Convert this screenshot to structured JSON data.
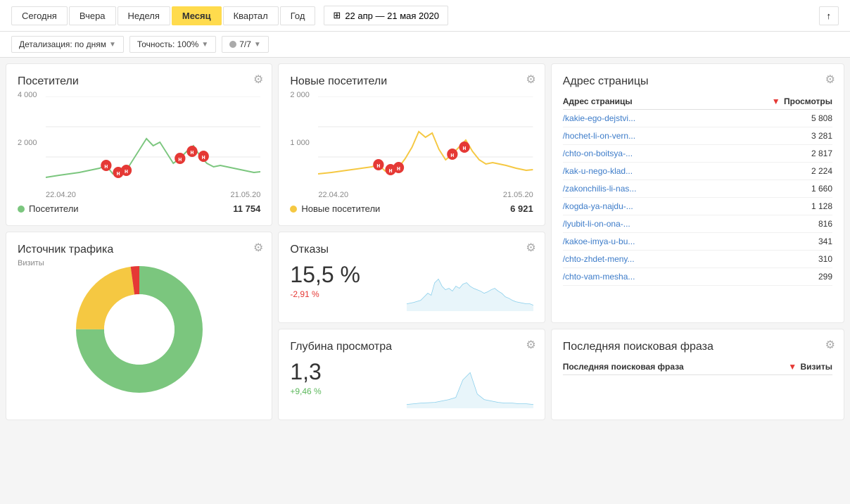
{
  "header": {
    "period_tabs": [
      {
        "label": "Сегодня",
        "active": false
      },
      {
        "label": "Вчера",
        "active": false
      },
      {
        "label": "Неделя",
        "active": false
      },
      {
        "label": "Месяц",
        "active": true
      },
      {
        "label": "Квартал",
        "active": false
      },
      {
        "label": "Год",
        "active": false
      }
    ],
    "date_range": "22 апр — 21 мая 2020",
    "export_icon": "↑"
  },
  "filters": {
    "detail_label": "Детализация: по дням",
    "accuracy_label": "Точность: 100%",
    "segments_label": "7/7"
  },
  "visitors_card": {
    "title": "Посетители",
    "y_labels": [
      "4 000",
      "2 000"
    ],
    "date_start": "22.04.20",
    "date_end": "21.05.20",
    "legend": "Посетители",
    "value": "11 754",
    "dot_color": "#7bc67e"
  },
  "new_visitors_card": {
    "title": "Новые посетители",
    "y_labels": [
      "2 000",
      "1 000"
    ],
    "date_start": "22.04.20",
    "date_end": "21.05.20",
    "legend": "Новые посетители",
    "value": "6 921",
    "dot_color": "#f5c842"
  },
  "address_card": {
    "title": "Адрес страницы",
    "col1": "Адрес страницы",
    "col2": "Просмотры",
    "rows": [
      {
        "url": "/kakie-ego-dejstvi...",
        "views": "5 808"
      },
      {
        "url": "/hochet-li-on-vern...",
        "views": "3 281"
      },
      {
        "url": "/chto-on-boitsya-...",
        "views": "2 817"
      },
      {
        "url": "/kak-u-nego-klad...",
        "views": "2 224"
      },
      {
        "url": "/zakonchilis-li-nas...",
        "views": "1 660"
      },
      {
        "url": "/kogda-ya-najdu-...",
        "views": "1 128"
      },
      {
        "url": "/lyubit-li-on-ona-...",
        "views": "816"
      },
      {
        "url": "/kakoe-imya-u-bu...",
        "views": "341"
      },
      {
        "url": "/chto-zhdet-meny...",
        "views": "310"
      },
      {
        "url": "/chto-vam-mesha...",
        "views": "299"
      }
    ]
  },
  "traffic_card": {
    "title": "Источник трафика",
    "subtitle": "Визиты"
  },
  "bounce_card": {
    "title": "Отказы",
    "value": "15,5 %",
    "change": "-2,91 %",
    "change_positive": false
  },
  "depth_card": {
    "title": "Глубина просмотра",
    "value": "1,3",
    "change": "+9,46 %",
    "change_positive": true
  },
  "last_phrase_card": {
    "title": "Последняя поисковая фраза",
    "col1": "Последняя поисковая фраза",
    "col2": "Визиты"
  },
  "colors": {
    "accent_yellow": "#ffdb4d",
    "link_blue": "#3d7cc9",
    "green": "#7bc67e",
    "yellow_chart": "#f5c842",
    "light_blue": "#87ceeb",
    "red": "#e53935"
  }
}
